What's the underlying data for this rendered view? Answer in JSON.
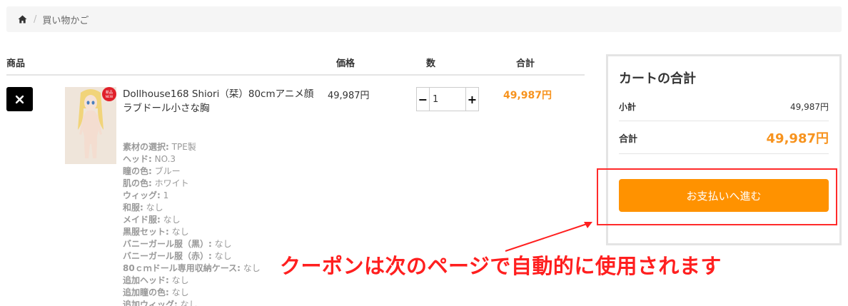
{
  "breadcrumb": {
    "home_icon": "home-icon",
    "separator": "/",
    "current": "買い物かご"
  },
  "table": {
    "headers": {
      "product": "商品",
      "price": "価格",
      "quantity": "数",
      "total": "合計"
    },
    "item": {
      "name": "Dollhouse168 Shiori（栞）80cmアニメ顔ラブドール小さな胸",
      "badge_text": "新品 NEW",
      "attributes": [
        {
          "key": "素材の選択:",
          "value": "TPE製"
        },
        {
          "key": "ヘッド:",
          "value": "NO.3"
        },
        {
          "key": "瞳の色:",
          "value": "ブルー"
        },
        {
          "key": "肌の色:",
          "value": "ホワイト"
        },
        {
          "key": "ウィッグ:",
          "value": "1"
        },
        {
          "key": "和服:",
          "value": "なし"
        },
        {
          "key": "メイド服:",
          "value": "なし"
        },
        {
          "key": "黒服セット:",
          "value": "なし"
        },
        {
          "key": "バニーガール服（黒）:",
          "value": "なし"
        },
        {
          "key": "バニーガール服（赤）:",
          "value": "なし"
        },
        {
          "key": "80ｃｍドール専用収納ケース:",
          "value": "なし"
        },
        {
          "key": "追加ヘッド:",
          "value": "なし"
        },
        {
          "key": "追加瞳の色:",
          "value": "なし"
        },
        {
          "key": "追加ウィッグ:",
          "value": "なし"
        }
      ],
      "price": "49,987円",
      "quantity": "1",
      "qty_minus": "−",
      "qty_plus": "+",
      "line_total": "49,987円"
    }
  },
  "summary": {
    "title": "カートの合計",
    "subtotal_label": "小計",
    "subtotal_value": "49,987円",
    "total_label": "合計",
    "total_value": "49,987円",
    "checkout_label": "お支払いへ進む"
  },
  "annotation": {
    "coupon_note": "クーポンは次のページで自動的に使用されます"
  },
  "colors": {
    "accent_orange": "#ff9200",
    "price_orange": "#f7931e",
    "annotation_red": "#ff1f1f"
  }
}
